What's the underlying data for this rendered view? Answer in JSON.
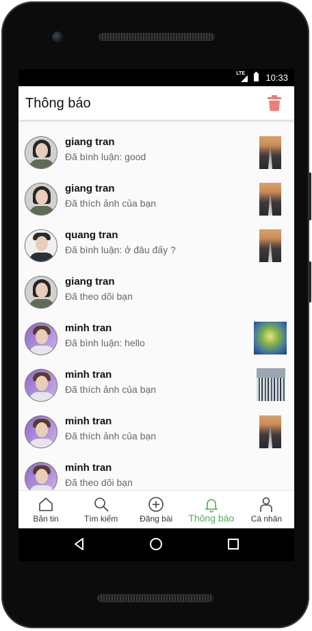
{
  "status_bar": {
    "time": "10:33",
    "network": "LTE"
  },
  "app_bar": {
    "title": "Thông báo",
    "action_icon": "trash-icon",
    "action_color": "#ef7c78"
  },
  "notifications": [
    {
      "name": "giang tran",
      "message": "Đã bình luận: good",
      "avatar": "giang",
      "thumbnail": "road-photo"
    },
    {
      "name": "giang tran",
      "message": "Đã thích ảnh của bạn",
      "avatar": "giang",
      "thumbnail": "road-photo"
    },
    {
      "name": "quang tran",
      "message": "Đã bình luận: ở đâu đấy ?",
      "avatar": "quang",
      "thumbnail": "road-photo"
    },
    {
      "name": "giang tran",
      "message": "Đã theo dõi bạn",
      "avatar": "giang",
      "thumbnail": ""
    },
    {
      "name": "minh tran",
      "message": "Đã bình luận: hello",
      "avatar": "minh",
      "thumbnail": "dragon-art"
    },
    {
      "name": "minh tran",
      "message": "Đã thích ảnh của bạn",
      "avatar": "minh",
      "thumbnail": "crowd-photo"
    },
    {
      "name": "minh tran",
      "message": "Đã thích ảnh của bạn",
      "avatar": "minh",
      "thumbnail": "road-photo"
    },
    {
      "name": "minh tran",
      "message": "Đã theo dõi bạn",
      "avatar": "minh",
      "thumbnail": ""
    }
  ],
  "tabs": [
    {
      "label": "Bản tin",
      "icon": "home-icon",
      "active": false
    },
    {
      "label": "Tìm kiếm",
      "icon": "search-icon",
      "active": false
    },
    {
      "label": "Đăng bài",
      "icon": "add-circle-icon",
      "active": false
    },
    {
      "label": "Thông báo",
      "icon": "bell-icon",
      "active": true
    },
    {
      "label": "Cá nhân",
      "icon": "person-icon",
      "active": false
    }
  ],
  "colors": {
    "accent": "#4caf50",
    "trash": "#ef7c78",
    "text_secondary": "#666666"
  },
  "system_nav": [
    "back-icon",
    "home-circle-icon",
    "recents-icon"
  ]
}
